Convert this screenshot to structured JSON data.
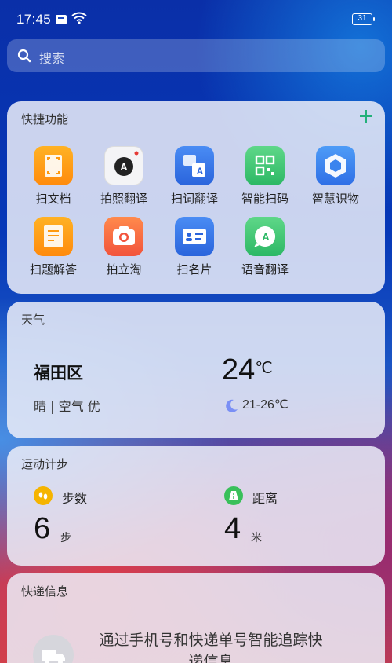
{
  "status_bar": {
    "time": "17:45",
    "battery": "31"
  },
  "search": {
    "placeholder": "搜索"
  },
  "shortcuts": {
    "title": "快捷功能",
    "apps": [
      {
        "label": "扫文档",
        "icon": "scan-document-icon"
      },
      {
        "label": "拍照翻译",
        "icon": "photo-translate-icon"
      },
      {
        "label": "扫词翻译",
        "icon": "word-translate-icon"
      },
      {
        "label": "智能扫码",
        "icon": "qr-code-icon"
      },
      {
        "label": "智慧识物",
        "icon": "object-recognition-icon"
      },
      {
        "label": "扫题解答",
        "icon": "question-solve-icon"
      },
      {
        "label": "拍立淘",
        "icon": "camera-icon"
      },
      {
        "label": "扫名片",
        "icon": "business-card-icon"
      },
      {
        "label": "语音翻译",
        "icon": "voice-translate-icon"
      }
    ]
  },
  "weather": {
    "title": "天气",
    "city": "福田区",
    "condition": "晴 | 空气 优",
    "temperature": "24",
    "temp_unit": "℃",
    "range": "21-26℃"
  },
  "steps": {
    "title": "运动计步",
    "steps_label": "步数",
    "steps_value": "6",
    "steps_unit": "步",
    "distance_label": "距离",
    "distance_value": "4",
    "distance_unit": "米"
  },
  "express": {
    "title": "快递信息",
    "message": "通过手机号和快递单号智能追踪快递信息"
  },
  "colors": {
    "accent_green": "#22b07a",
    "steps_badge": "#f5b400",
    "distance_badge": "#39c05a"
  }
}
